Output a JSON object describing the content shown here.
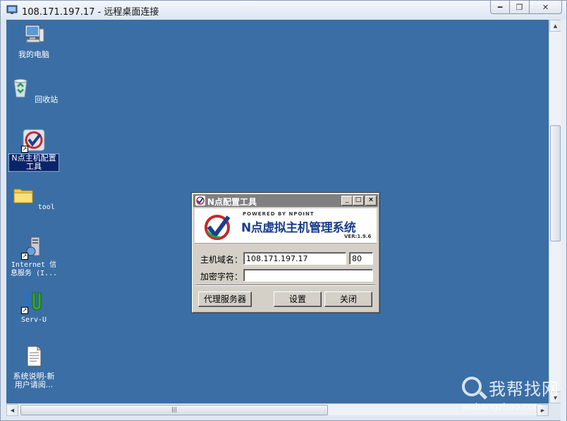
{
  "window": {
    "title": "108.171.197.17 - 远程桌面连接"
  },
  "desktop": {
    "icons": [
      {
        "label": "我的电脑",
        "icon": "my-computer-icon"
      },
      {
        "label": "回收站",
        "icon": "recycle-bin-icon"
      },
      {
        "label": "N点主机配置工具",
        "icon": "npoint-config-icon",
        "selected": true
      },
      {
        "label": "tool",
        "icon": "folder-icon"
      },
      {
        "label": "Internet 信息服务 (I...",
        "icon": "iis-icon"
      },
      {
        "label": "Serv-U",
        "icon": "servu-icon"
      },
      {
        "label": "系统说明-新用户请阅...",
        "icon": "text-document-icon"
      }
    ]
  },
  "dialog": {
    "title": "N点配置工具",
    "banner": {
      "powered": "POWERED BY NPOINT",
      "brand": "N点虚拟主机管理系统",
      "version": "VER:1.9.6"
    },
    "host_label": "主机域名：",
    "host_value": "108.171.197.17",
    "port_value": "80",
    "key_label": "加密字符：",
    "key_value": "",
    "proxy_button": "代理服务器",
    "settings_button": "设置",
    "close_button": "关闭"
  },
  "watermark": {
    "name": "我帮找网",
    "url": "wobangzhao.com"
  },
  "colors": {
    "desktop": "#3a6ea5",
    "dialog_face": "#d4d0c8",
    "brand": "#1a3e8c"
  }
}
